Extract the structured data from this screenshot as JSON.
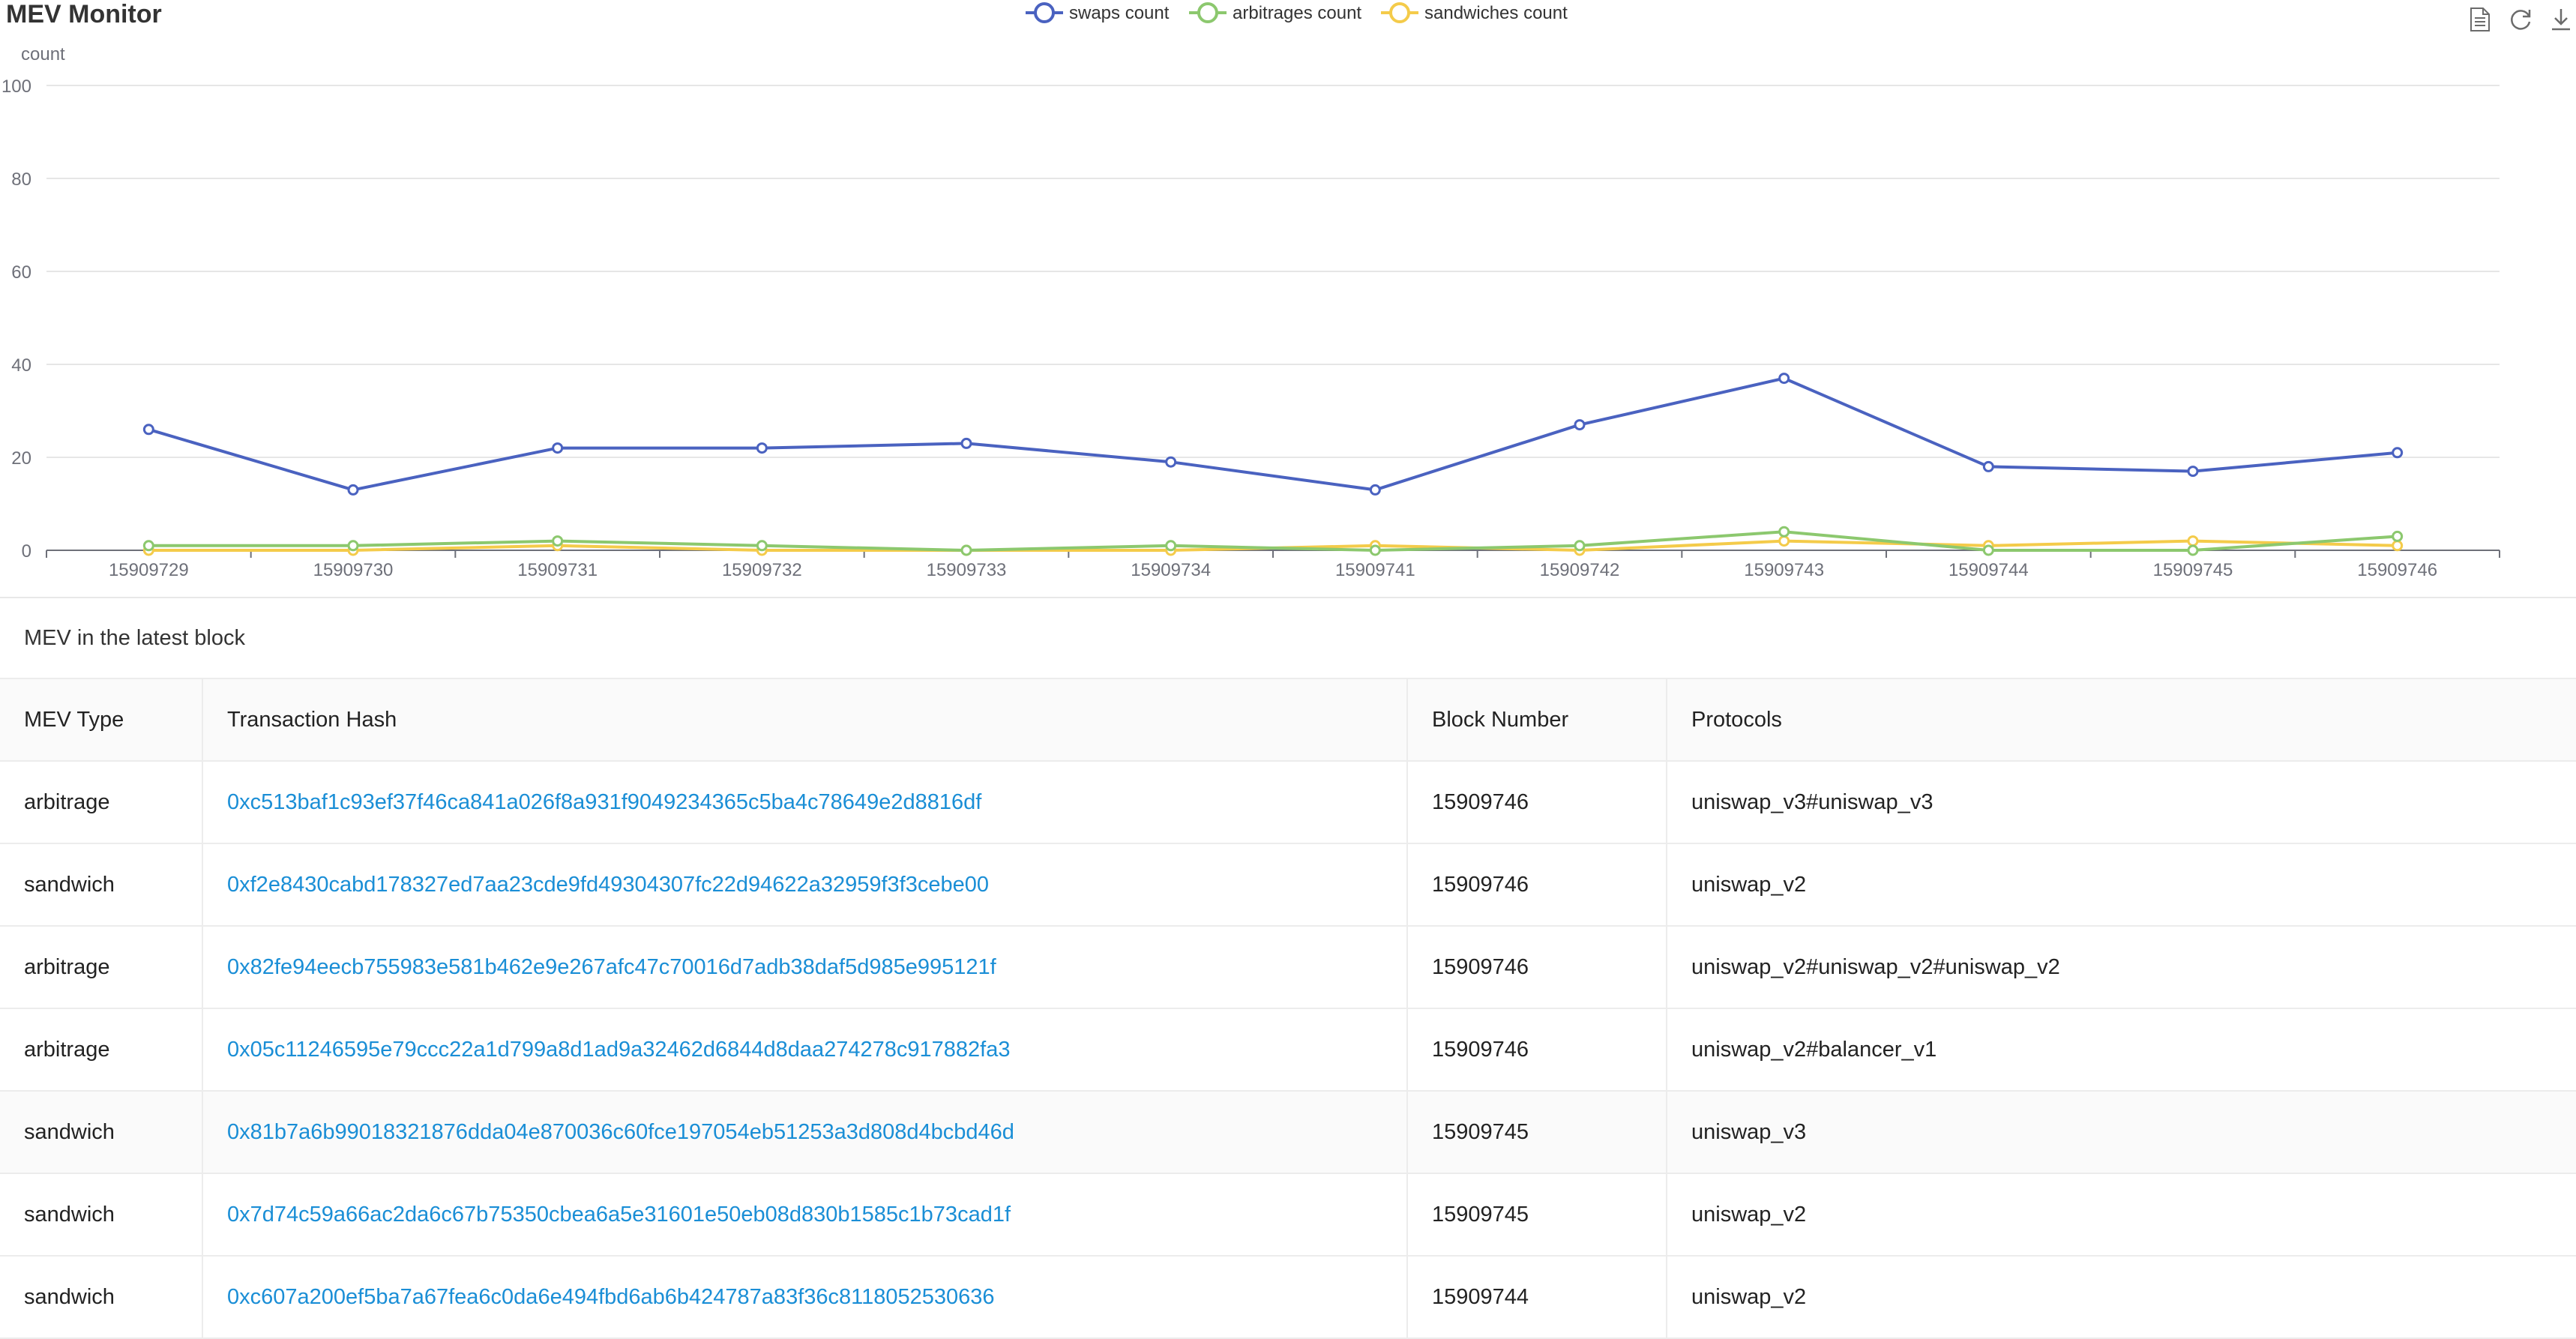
{
  "app": {
    "title": "MEV Monitor"
  },
  "toolbox": [
    {
      "name": "data-view-icon"
    },
    {
      "name": "restore-icon"
    },
    {
      "name": "save-image-icon"
    }
  ],
  "chart_data": {
    "type": "line",
    "ylabel": "count",
    "ylim": [
      0,
      100
    ],
    "yticks": [
      0,
      20,
      40,
      60,
      80,
      100
    ],
    "grid": true,
    "legend_position": "top-center",
    "categories": [
      "15909729",
      "15909730",
      "15909731",
      "15909732",
      "15909733",
      "15909734",
      "15909741",
      "15909742",
      "15909743",
      "15909744",
      "15909745",
      "15909746"
    ],
    "series": [
      {
        "name": "swaps count",
        "color": "#4a62c0",
        "values": [
          26,
          13,
          22,
          22,
          23,
          19,
          13,
          27,
          37,
          18,
          17,
          21
        ]
      },
      {
        "name": "arbitrages count",
        "color": "#8cc86e",
        "values": [
          1,
          1,
          2,
          1,
          0,
          1,
          0,
          1,
          4,
          0,
          0,
          3
        ]
      },
      {
        "name": "sandwiches count",
        "color": "#f4cb4a",
        "values": [
          0,
          0,
          1,
          0,
          0,
          0,
          1,
          0,
          2,
          1,
          2,
          1
        ]
      }
    ]
  },
  "table": {
    "title": "MEV in the latest block",
    "columns": [
      "MEV Type",
      "Transaction Hash",
      "Block Number",
      "Protocols"
    ],
    "rows": [
      {
        "type": "arbitrage",
        "hash": "0xc513baf1c93ef37f46ca841a026f8a931f9049234365c5ba4c78649e2d8816df",
        "block": "15909746",
        "protocols": "uniswap_v3#uniswap_v3"
      },
      {
        "type": "sandwich",
        "hash": "0xf2e8430cabd178327ed7aa23cde9fd49304307fc22d94622a32959f3f3cebe00",
        "block": "15909746",
        "protocols": "uniswap_v2"
      },
      {
        "type": "arbitrage",
        "hash": "0x82fe94eecb755983e581b462e9e267afc47c70016d7adb38daf5d985e995121f",
        "block": "15909746",
        "protocols": "uniswap_v2#uniswap_v2#uniswap_v2"
      },
      {
        "type": "arbitrage",
        "hash": "0x05c11246595e79ccc22a1d799a8d1ad9a32462d6844d8daa274278c917882fa3",
        "block": "15909746",
        "protocols": "uniswap_v2#balancer_v1"
      },
      {
        "type": "sandwich",
        "hash": "0x81b7a6b99018321876dda04e870036c60fce197054eb51253a3d808d4bcbd46d",
        "block": "15909745",
        "protocols": "uniswap_v3"
      },
      {
        "type": "sandwich",
        "hash": "0x7d74c59a66ac2da6c67b75350cbea6a5e31601e50eb08d830b1585c1b73cad1f",
        "block": "15909745",
        "protocols": "uniswap_v2"
      },
      {
        "type": "sandwich",
        "hash": "0xc607a200ef5ba7a67fea6c0da6e494fbd6ab6b424787a83f36c8118052530636",
        "block": "15909744",
        "protocols": "uniswap_v2"
      }
    ]
  }
}
